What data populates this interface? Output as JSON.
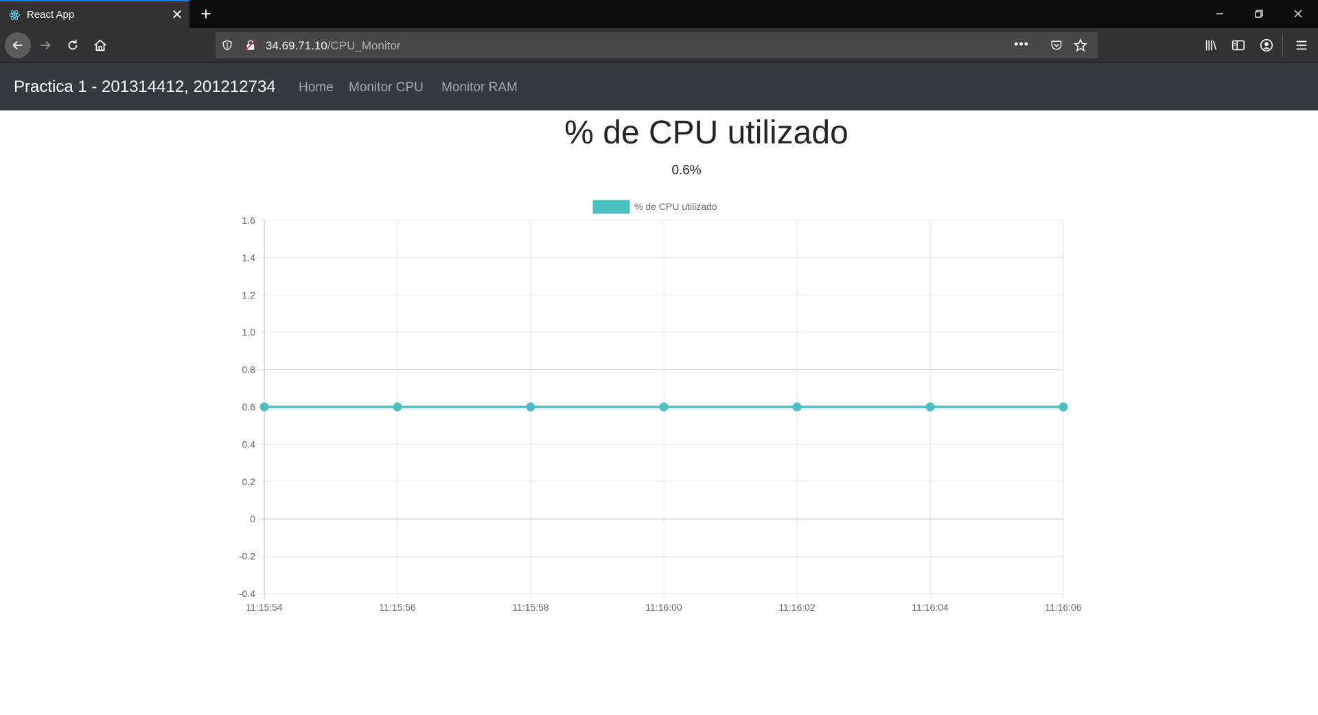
{
  "browser": {
    "tab_title": "React App",
    "url_host": "34.69.71.10",
    "url_path": "/CPU_Monitor",
    "page_actions": "•••"
  },
  "app": {
    "brand": "Practica 1 - 201314412, 201212734",
    "nav": [
      "Home",
      "Monitor CPU",
      "Monitor RAM"
    ]
  },
  "page": {
    "title": "% de CPU utilizado",
    "current_value": "0.6%"
  },
  "colors": {
    "series": "#4bc0c0",
    "navbar": "#343a40"
  },
  "chart_data": {
    "type": "line",
    "x": [
      "11:15:54",
      "11:15:56",
      "11:15:58",
      "11:16:00",
      "11:16:02",
      "11:16:04",
      "11:16:06"
    ],
    "series": [
      {
        "name": "% de CPU utilizado",
        "values": [
          0.6,
          0.6,
          0.6,
          0.6,
          0.6,
          0.6,
          0.6
        ],
        "color": "#4bc0c0"
      }
    ],
    "ylim": [
      -0.4,
      1.6
    ],
    "yticks": [
      "1.6",
      "1.4",
      "1.2",
      "1.0",
      "0.8",
      "0.6",
      "0.4",
      "0.2",
      "0",
      "-0.2",
      "-0.4"
    ],
    "grid": true,
    "legend": "top-center"
  }
}
